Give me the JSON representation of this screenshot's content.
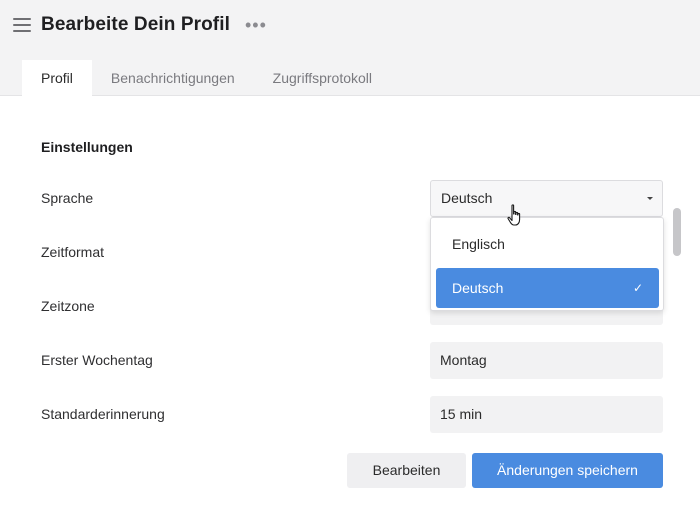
{
  "header": {
    "title": "Bearbeite Dein Profil",
    "menu_icon": "hamburger-menu-icon",
    "more_icon": "more-horizontal-icon",
    "more_glyph": "•••"
  },
  "tabs": [
    {
      "label": "Profil",
      "active": true
    },
    {
      "label": "Benachrichtigungen",
      "active": false
    },
    {
      "label": "Zugriffsprotokoll",
      "active": false
    }
  ],
  "settings": {
    "section_title": "Einstellungen",
    "language": {
      "label": "Sprache",
      "value": "Deutsch"
    },
    "time_format": {
      "label": "Zeitformat"
    },
    "timezone": {
      "label": "Zeitzone"
    },
    "first_weekday": {
      "label": "Erster Wochentag",
      "value": "Montag"
    },
    "default_reminder": {
      "label": "Standarderinnerung",
      "value": "15 min"
    }
  },
  "dropdown": {
    "options": [
      {
        "label": "Englisch",
        "selected": false
      },
      {
        "label": "Deutsch",
        "selected": true
      }
    ],
    "check_glyph": "✓"
  },
  "buttons": {
    "edit": "Bearbeiten",
    "save": "Änderungen speichern"
  },
  "colors": {
    "accent": "#4a8be0",
    "header_bg": "#f3f3f4",
    "field_bg": "#f2f2f3"
  }
}
